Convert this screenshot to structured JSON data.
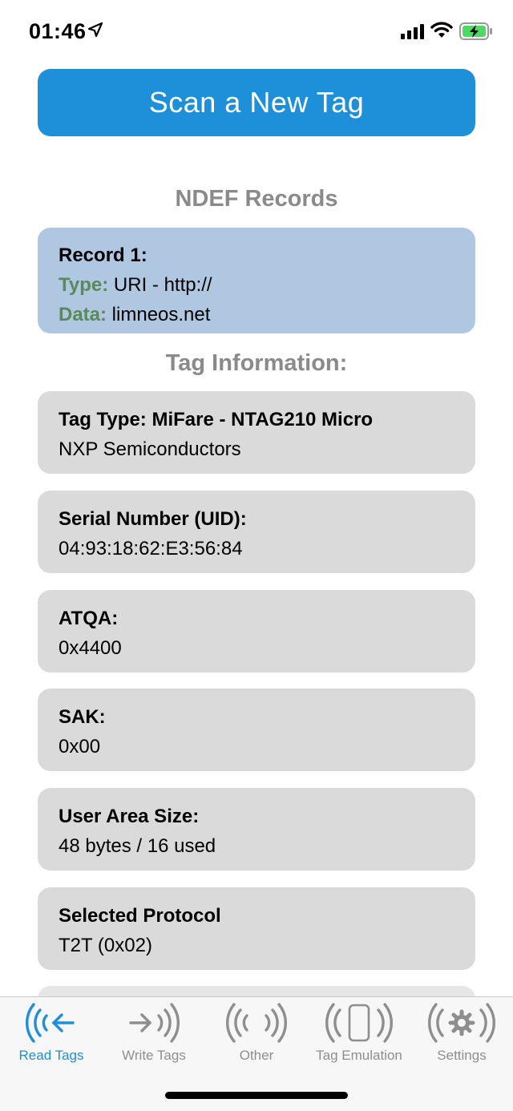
{
  "status_bar": {
    "time": "01:46",
    "icons": [
      "location-arrow-icon",
      "signal-icon",
      "wifi-icon",
      "battery-charging-icon"
    ]
  },
  "scan_button": {
    "label": "Scan a New Tag"
  },
  "ndef": {
    "title": "NDEF Records",
    "record": {
      "heading": "Record 1:",
      "type_label": "Type:",
      "type_value": " URI - http://",
      "data_label": "Data:",
      "data_value": " limneos.net"
    }
  },
  "tag_info": {
    "title": "Tag Information:",
    "cards": [
      {
        "label": "Tag Type: MiFare - NTAG210 Micro",
        "value": "NXP Semiconductors"
      },
      {
        "label": "Serial Number (UID):",
        "value": "04:93:18:62:E3:56:84"
      },
      {
        "label": "ATQA:",
        "value": "0x4400"
      },
      {
        "label": "SAK:",
        "value": "0x00"
      },
      {
        "label": "User Area Size:",
        "value": "48 bytes / 16 used"
      },
      {
        "label": "Selected Protocol",
        "value": "T2T (0x02)"
      }
    ]
  },
  "tab_bar": {
    "tabs": [
      {
        "label": "Read Tags",
        "icon": "read-tags-icon",
        "active": true
      },
      {
        "label": "Write Tags",
        "icon": "write-tags-icon",
        "active": false
      },
      {
        "label": "Other",
        "icon": "other-icon",
        "active": false
      },
      {
        "label": "Tag Emulation",
        "icon": "tag-emulation-icon",
        "active": false
      },
      {
        "label": "Settings",
        "icon": "settings-icon",
        "active": false
      }
    ]
  },
  "colors": {
    "accent": "#1e8fd9",
    "record_card": "#b0c7e2",
    "info_card": "#dadada",
    "label_green": "#5a8a5a",
    "section_title": "#8a8a8a",
    "battery_green": "#4cd964"
  }
}
